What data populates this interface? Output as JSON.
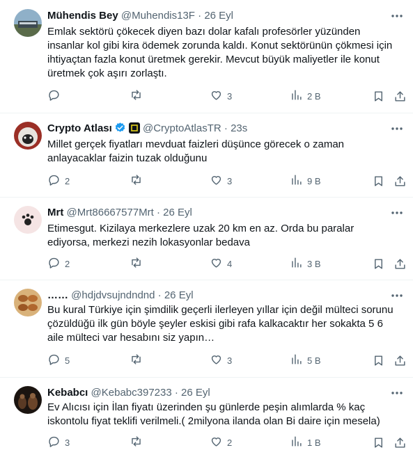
{
  "tweets": [
    {
      "name": "Mühendis Bey",
      "handle": "@Muhendis13F",
      "time": "26 Eyl",
      "text": "Emlak sektörü çökecek diyen bazı dolar kafalı profesörler yüzünden insanlar kol gibi kira ödemek zorunda kaldı. Konut sektörünün çökmesi için ihtiyaçtan fazla konut üretmek gerekir. Mevcut büyük maliyetler ile konut üretmek çok aşırı zorlaştı.",
      "replies": "",
      "reposts": "",
      "likes": "3",
      "views": "2 B"
    },
    {
      "name": "Crypto Atlası",
      "handle": "@CryptoAtlasTR",
      "time": "23s",
      "text": "Millet gerçek fiyatları mevduat faizleri düşünce görecek o zaman anlayacaklar faizin tuzak olduğunu",
      "replies": "2",
      "reposts": "",
      "likes": "3",
      "views": "9 B"
    },
    {
      "name": "Mrt",
      "handle": "@Mrt86667577Mrt",
      "time": "26 Eyl",
      "text": "Etimesgut. Kizilaya merkezlere uzak 20 km en az. Orda bu paralar ediyorsa, merkezi nezih lokasyonlar bedava",
      "replies": "2",
      "reposts": "",
      "likes": "4",
      "views": "3 B"
    },
    {
      "name": "……",
      "handle": "@hdjdvsujndndnd",
      "time": "26 Eyl",
      "text": "Bu kural Türkiye için şimdilik geçerli ilerleyen yıllar için değil mülteci sorunu çözüldüğü ilk gün böyle şeyler eskisi gibi rafa kalkacaktır  her sokakta 5 6 aile mülteci var hesabını siz yapın…",
      "replies": "5",
      "reposts": "",
      "likes": "3",
      "views": "5 B"
    },
    {
      "name": "Kebabcı",
      "handle": "@Kebabc397233",
      "time": "26 Eyl",
      "text": "Ev Alıcısı için İlan fiyatı üzerinden şu günlerde peşin alımlarda % kaç iskontolu fiyat teklifi verilmeli.( 2milyona ilanda olan Bi daire için mesela)",
      "replies": "3",
      "reposts": "",
      "likes": "2",
      "views": "1 B"
    }
  ],
  "separator": "·",
  "colors": {
    "text": "#0f1419",
    "meta": "#536471",
    "verified": "#1d9bf0",
    "border": "#eff3f4"
  },
  "icons": [
    "more-icon",
    "reply-icon",
    "repost-icon",
    "like-icon",
    "views-icon",
    "bookmark-icon",
    "share-icon",
    "verified-badge-icon"
  ]
}
